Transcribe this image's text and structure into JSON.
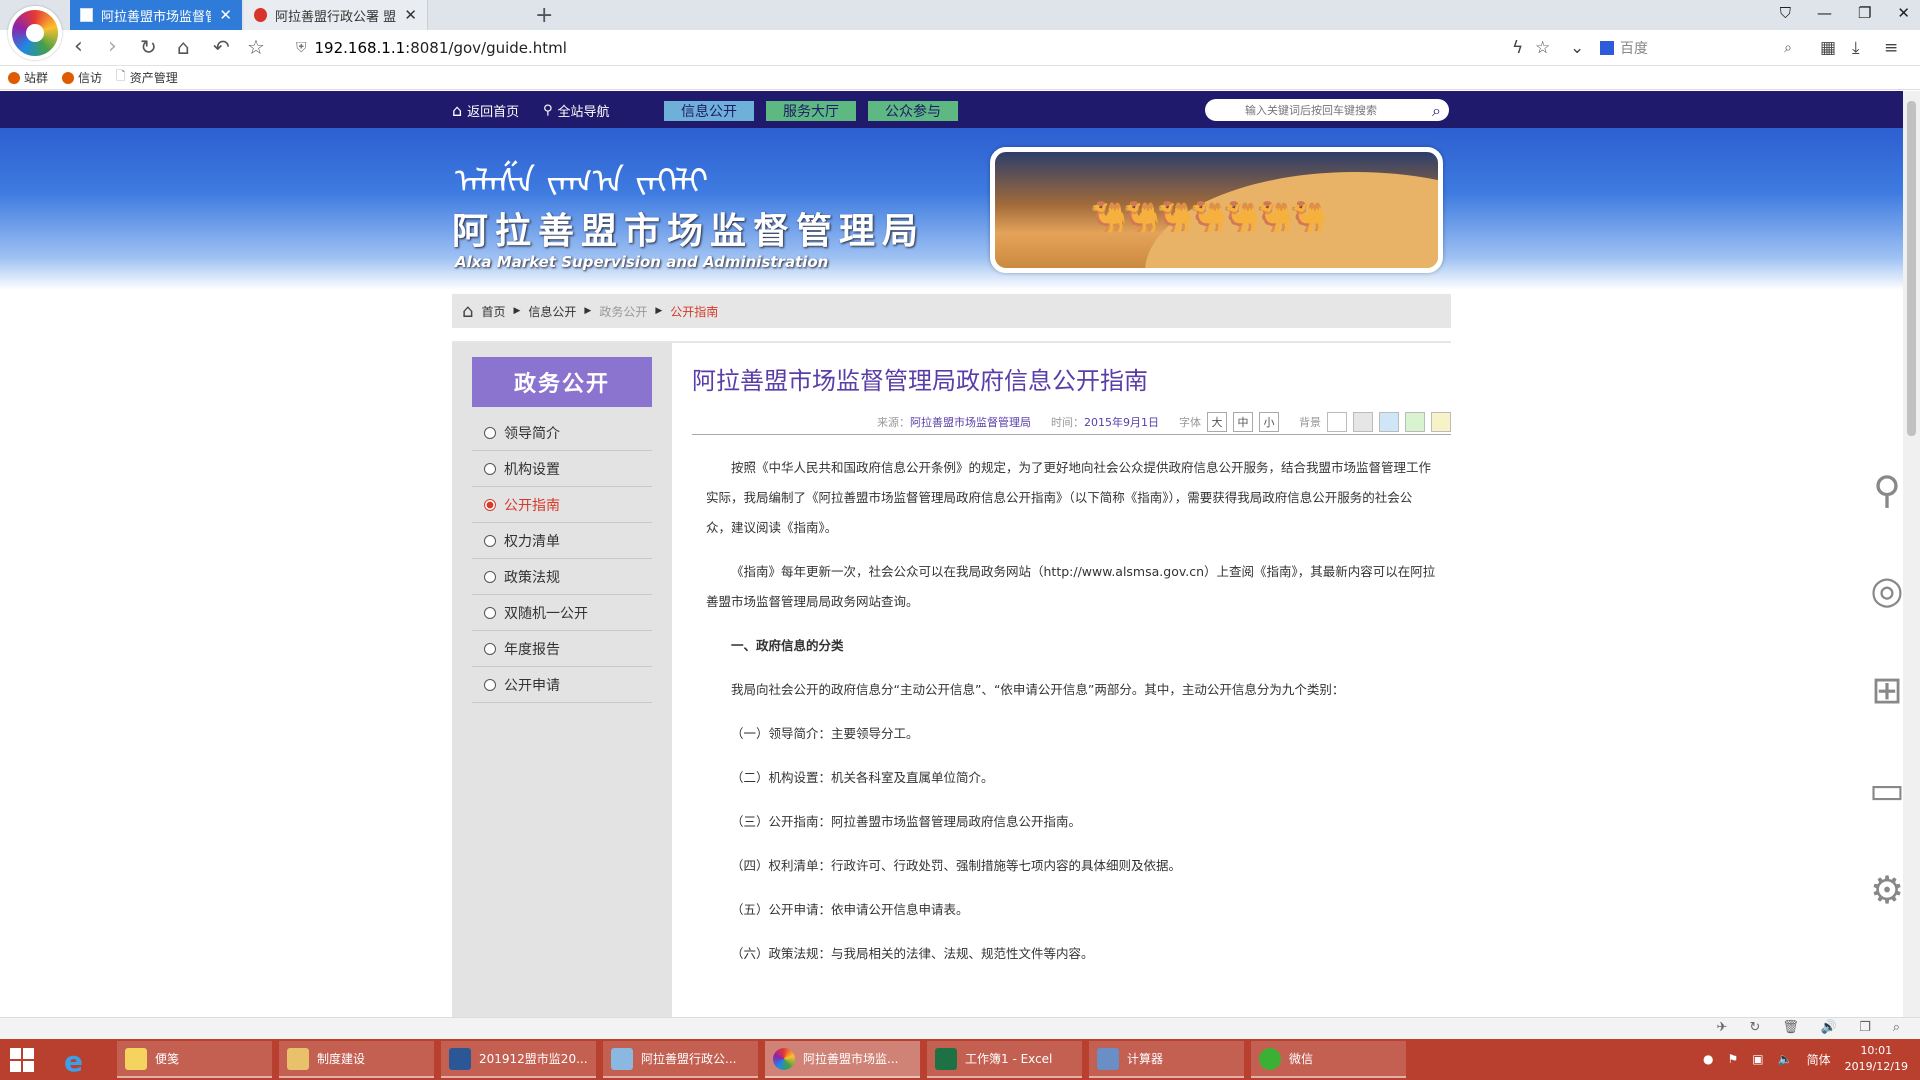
{
  "browser": {
    "tabs": [
      {
        "label": "阿拉善盟市场监督管理局 - 公开",
        "active": true
      },
      {
        "label": "阿拉善盟行政公署 盟本级年度扎",
        "active": false
      }
    ],
    "new_tab": "+",
    "address": {
      "host": "192.168.1.1",
      "rest": ":8081/gov/guide.html"
    },
    "search_placeholder": "百度",
    "bookmarks": [
      "站群",
      "信访",
      "资产管理"
    ]
  },
  "site": {
    "topnav": {
      "home": "返回首页",
      "sitemap": "全站导航",
      "tabs": [
        "信息公开",
        "服务大厅",
        "公众参与"
      ],
      "search_placeholder": "输入关键词后按回车键搜索"
    },
    "banner": {
      "mongolian": "ᠠᠯᠠᠱᠠ ᠵᠠᠬ᠎ᠠ ᠵᠡᠭᠡᠯᠢ",
      "name_zh": "阿拉善盟市场监督管理局",
      "name_en": "Alxa Market Supervision and Administration"
    },
    "breadcrumb": [
      "首页",
      "信息公开",
      "政务公开",
      "公开指南"
    ],
    "sidebar": {
      "title": "政务公开",
      "items": [
        {
          "label": "领导简介",
          "active": false
        },
        {
          "label": "机构设置",
          "active": false
        },
        {
          "label": "公开指南",
          "active": true
        },
        {
          "label": "权力清单",
          "active": false
        },
        {
          "label": "政策法规",
          "active": false
        },
        {
          "label": "双随机一公开",
          "active": false
        },
        {
          "label": "年度报告",
          "active": false
        },
        {
          "label": "公开申请",
          "active": false
        }
      ]
    },
    "article": {
      "title": "阿拉善盟市场监督管理局政府信息公开指南",
      "source_label": "来源：",
      "source": "阿拉善盟市场监督管理局",
      "time_label": "时间：",
      "time": "2015年9月1日",
      "font_label": "字体",
      "font_sizes": [
        "大",
        "中",
        "小"
      ],
      "bg_label": "背景",
      "bg_swatches": [
        "#ffffff",
        "#e6e6e6",
        "#cfe6f7",
        "#d9f2d0",
        "#f7f2c8"
      ],
      "paragraphs": [
        "按照《中华人民共和国政府信息公开条例》的规定，为了更好地向社会公众提供政府信息公开服务，结合我盟市场监督管理工作实际，我局编制了《阿拉善盟市场监督管理局政府信息公开指南》（以下简称《指南》），需要获得我局政府信息公开服务的社会公众，建议阅读《指南》。",
        "《指南》每年更新一次，社会公众可以在我局政务网站（http://www.alsmsa.gov.cn）上查阅《指南》，其最新内容可以在阿拉善盟市场监督管理局局政务网站查询。",
        "一、政府信息的分类",
        "我局向社会公开的政府信息分“主动公开信息”、“依申请公开信息”两部分。其中，主动公开信息分为九个类别：",
        "（一）领导简介：主要领导分工。",
        "（二）机构设置：机关各科室及直属单位简介。",
        "（三）公开指南：阿拉善盟市场监督管理局政府信息公开指南。",
        "（四）权利清单：行政许可、行政处罚、强制措施等七项内容的具体细则及依据。",
        "（五）公开申请：依申请公开信息申请表。",
        "（六）政策法规：与我局相关的法律、法规、规范性文件等内容。"
      ]
    }
  },
  "taskbar": {
    "items": [
      {
        "label": "便笺",
        "color": "#f4d35e"
      },
      {
        "label": "制度建设",
        "color": "#e8c16a"
      },
      {
        "label": "201912盟市监20...",
        "color": "#2b5797"
      },
      {
        "label": "阿拉善盟行政公...",
        "color": "#8bb8e0"
      },
      {
        "label": "阿拉善盟市场监...",
        "color": "#e05a9a"
      },
      {
        "label": "工作簿1 - Excel",
        "color": "#1e7145"
      },
      {
        "label": "计算器",
        "color": "#6a8fc7"
      },
      {
        "label": "微信",
        "color": "#3cb034"
      }
    ],
    "ime": "简体",
    "time": "10:01",
    "date": "2019/12/19"
  }
}
